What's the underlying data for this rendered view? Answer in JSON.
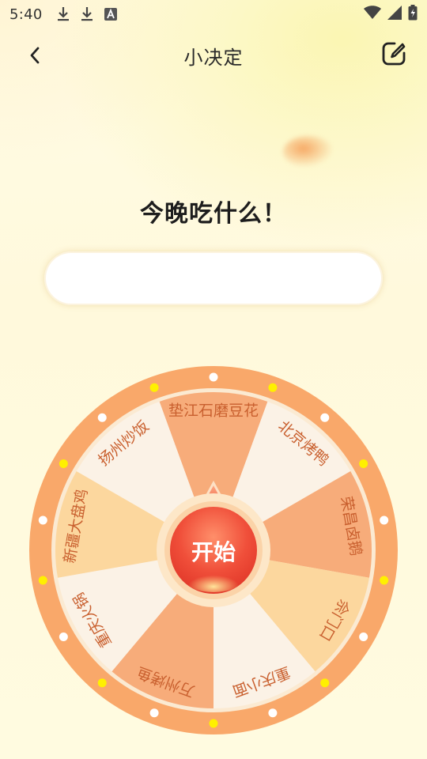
{
  "status_bar": {
    "time": "5:40",
    "icons": [
      "download-icon",
      "download-icon",
      "font-a-icon"
    ],
    "right_icons": [
      "wifi-icon",
      "signal-icon",
      "battery-charging-icon"
    ]
  },
  "header": {
    "title": "小决定",
    "back_icon": "chevron-left-icon",
    "edit_icon": "edit-square-icon"
  },
  "question": "今晚吃什么！",
  "answer": {
    "value": "",
    "placeholder": ""
  },
  "wheel": {
    "start_label": "开始",
    "segments": [
      {
        "label": "垫江石磨豆花",
        "color": "#f7ac7a"
      },
      {
        "label": "北京烤鸭",
        "color": "#fbf2e6"
      },
      {
        "label": "荣昌卤鹅",
        "color": "#f7ac7a"
      },
      {
        "label": "佘门口",
        "color": "#fcd79e"
      },
      {
        "label": "重庆小面",
        "color": "#fbf2e6"
      },
      {
        "label": "万州烤鱼",
        "color": "#f7ac7a"
      },
      {
        "label": "重庆火锅",
        "color": "#fbf2e6"
      },
      {
        "label": "新疆大盘鸡",
        "color": "#fcd79e"
      },
      {
        "label": "扬州炒饭",
        "color": "#fbf2e6"
      }
    ],
    "rim_color": "#f9a86a",
    "dot_colors": [
      "#ffffff",
      "#fff000"
    ],
    "label_color": "#c9602f"
  }
}
